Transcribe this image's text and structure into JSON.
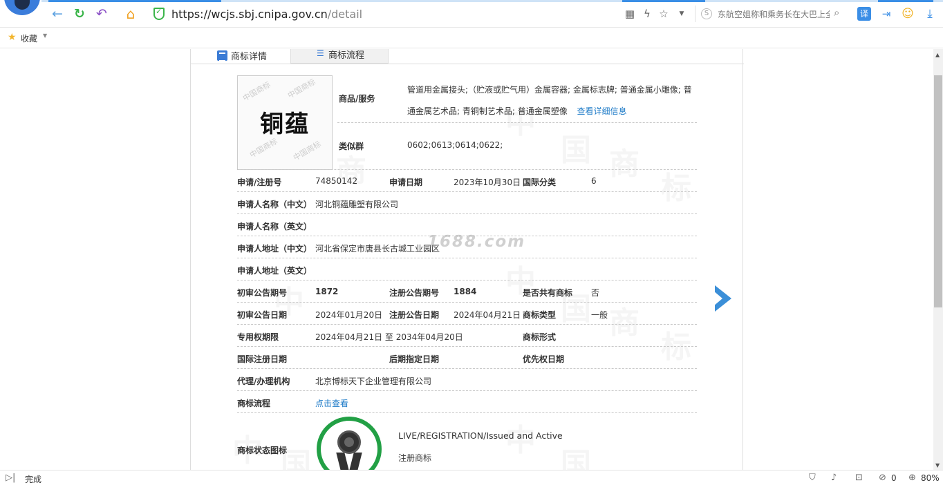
{
  "browser": {
    "url_host": "https://wcjs.sbj.cnipa.gov.cn",
    "url_path": "/detail",
    "search_text": "东航空姐称和乘务长在大巴上全",
    "favorites_label": "收藏",
    "status_text": "完成",
    "counter": "0",
    "zoom": "80%"
  },
  "tabs": [
    {
      "label": "商标详情"
    },
    {
      "label": "商标流程"
    }
  ],
  "trademark": {
    "image_text": "铜蕴",
    "goods_label": "商品/服务",
    "goods_value": "管道用金属接头;（贮液或贮气用）金属容器; 金属标志牌; 普通金属小雕像; 普通金属艺术品; 青铜制艺术品; 普通金属塑像",
    "goods_link": "查看详细信息",
    "similar_label": "类似群",
    "similar_value": "0602;0613;0614;0622;"
  },
  "rows": {
    "reg_no_label": "申请/注册号",
    "reg_no": "74850142",
    "apply_date_label": "申请日期",
    "apply_date": "2023年10月30日",
    "intl_class_label": "国际分类",
    "intl_class": "6",
    "applicant_cn_label": "申请人名称（中文）",
    "applicant_cn": "河北铜蕴雕塑有限公司",
    "applicant_en_label": "申请人名称（英文）",
    "address_cn_label": "申请人地址（中文）",
    "address_cn": "河北省保定市唐县长古城工业园区",
    "address_en_label": "申请人地址（英文）",
    "prelim_no_label": "初审公告期号",
    "prelim_no": "1872",
    "reg_notice_no_label": "注册公告期号",
    "reg_notice_no": "1884",
    "shared_label": "是否共有商标",
    "shared": "否",
    "prelim_date_label": "初审公告日期",
    "prelim_date": "2024年01月20日",
    "reg_notice_date_label": "注册公告日期",
    "reg_notice_date": "2024年04月21日",
    "tm_type_label": "商标类型",
    "tm_type": "一般",
    "exclusive_label": "专用权期限",
    "exclusive": "2024年04月21日 至 2034年04月20日",
    "tm_form_label": "商标形式",
    "intl_reg_label": "国际注册日期",
    "later_label": "后期指定日期",
    "priority_label": "优先权日期",
    "agent_label": "代理/办理机构",
    "agent": "北京博标天下企业管理有限公司",
    "flow_label": "商标流程",
    "flow_link": "点击查看",
    "status_icon_label": "商标状态图标",
    "status_en": "LIVE/REGISTRATION/Issued and Active",
    "status_cn": "注册商标"
  },
  "watermark": "1688.com"
}
